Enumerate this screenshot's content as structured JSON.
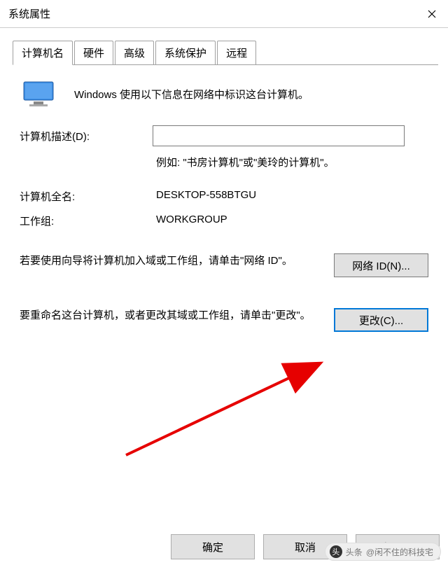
{
  "window": {
    "title": "系统属性"
  },
  "tabs": {
    "computer_name": "计算机名",
    "hardware": "硬件",
    "advanced": "高级",
    "sys_protection": "系统保护",
    "remote": "远程"
  },
  "panel": {
    "intro": "Windows 使用以下信息在网络中标识这台计算机。",
    "desc_label": "计算机描述(D):",
    "desc_value": "",
    "desc_example": "例如: \"书房计算机\"或\"美玲的计算机\"。",
    "fullname_label": "计算机全名:",
    "fullname_value": "DESKTOP-558BTGU",
    "workgroup_label": "工作组:",
    "workgroup_value": "WORKGROUP",
    "netid_text": "若要使用向导将计算机加入域或工作组，请单击\"网络 ID\"。",
    "netid_btn": "网络 ID(N)...",
    "change_text": "要重命名这台计算机，或者更改其域或工作组，请单击\"更改\"。",
    "change_btn": "更改(C)..."
  },
  "buttons": {
    "ok": "确定",
    "cancel": "取消",
    "apply": "应用(A)"
  },
  "watermark": {
    "prefix": "头条",
    "author": "@闲不住的科技宅"
  }
}
